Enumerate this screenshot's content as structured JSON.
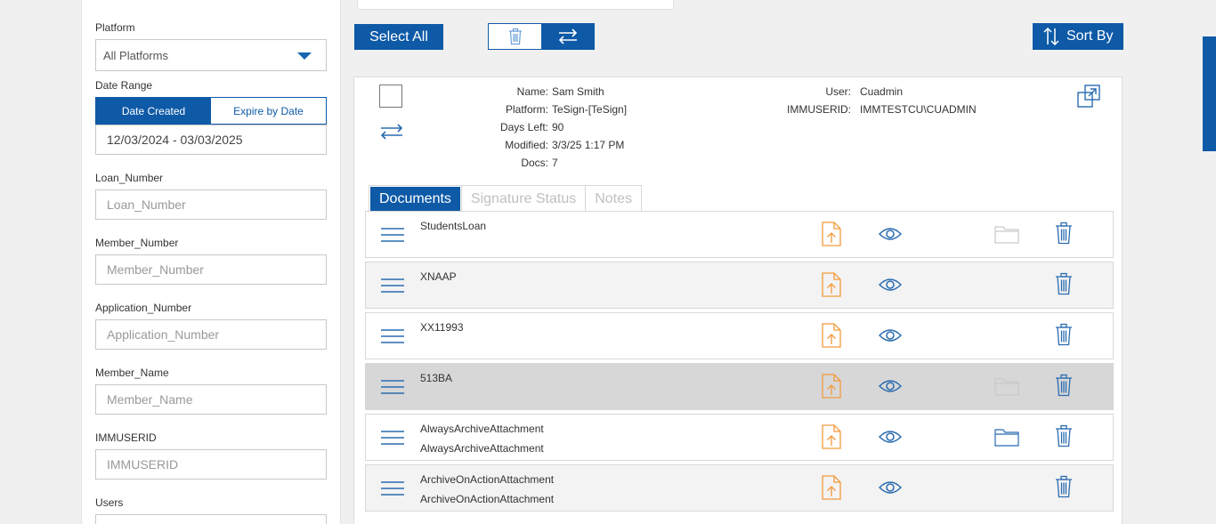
{
  "filters": {
    "platform_label": "Platform",
    "platform_value": "All Platforms",
    "date_range_label": "Date Range",
    "date_toggle": {
      "created": "Date Created",
      "expire": "Expire by Date",
      "selected": "created"
    },
    "date_range_value": "12/03/2024 - 03/03/2025",
    "loan_number": {
      "label": "Loan_Number",
      "placeholder": "Loan_Number"
    },
    "member_number": {
      "label": "Member_Number",
      "placeholder": "Member_Number"
    },
    "application_number": {
      "label": "Application_Number",
      "placeholder": "Application_Number"
    },
    "member_name": {
      "label": "Member_Name",
      "placeholder": "Member_Name"
    },
    "immuserid": {
      "label": "IMMUSERID",
      "placeholder": "IMMUSERID"
    },
    "users": {
      "label": "Users"
    }
  },
  "toolbar": {
    "select_all": "Select All",
    "sort_by": "Sort By"
  },
  "package": {
    "name_label": "Name:",
    "name": "Sam Smith",
    "platform_label": "Platform:",
    "platform": "TeSign-[TeSign]",
    "days_left_label": "Days Left:",
    "days_left": "90",
    "modified_label": "Modified:",
    "modified": "3/3/25 1:17 PM",
    "docs_label": "Docs:",
    "docs": "7",
    "user_label": "User:",
    "user": "Cuadmin",
    "immuserid_label": "IMMUSERID:",
    "immuserid": "IMMTESTCU\\CUADMIN"
  },
  "tabs": {
    "documents": "Documents",
    "signature_status": "Signature Status",
    "notes": "Notes",
    "active": "documents"
  },
  "documents": [
    {
      "name": "StudentsLoan",
      "sub": "",
      "folder": "light"
    },
    {
      "name": "XNAAP",
      "sub": "",
      "folder": "none"
    },
    {
      "name": "XX11993",
      "sub": "",
      "folder": "none"
    },
    {
      "name": "513BA",
      "sub": "",
      "folder": "light",
      "selected": true
    },
    {
      "name": "AlwaysArchiveAttachment",
      "sub": "AlwaysArchiveAttachment",
      "folder": "blue"
    },
    {
      "name": "ArchiveOnActionAttachment",
      "sub": "ArchiveOnActionAttachment",
      "folder": "none"
    }
  ],
  "colors": {
    "primary": "#0e5aa7",
    "upload": "#f39a3b",
    "icon": "#2a6bb0"
  }
}
